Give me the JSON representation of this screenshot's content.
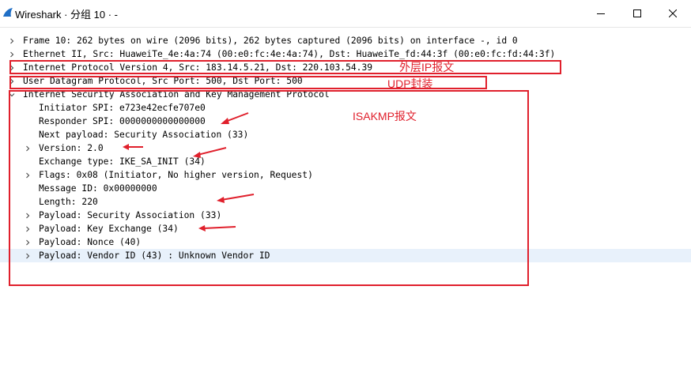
{
  "window": {
    "title": "Wireshark · 分组 10 · -",
    "controls": [
      "minimize",
      "maximize",
      "close"
    ]
  },
  "tree": {
    "rows": [
      {
        "text": "Frame 10: 262 bytes on wire (2096 bits), 262 bytes captured (2096 bits) on interface -, id 0",
        "level": 0,
        "state": "collapsed"
      },
      {
        "text": "Ethernet II, Src: HuaweiTe_4e:4a:74 (00:e0:fc:4e:4a:74), Dst: HuaweiTe_fd:44:3f (00:e0:fc:fd:44:3f)",
        "level": 0,
        "state": "collapsed"
      },
      {
        "text": "Internet Protocol Version 4, Src: 183.14.5.21, Dst: 220.103.54.39",
        "level": 0,
        "state": "collapsed"
      },
      {
        "text": "User Datagram Protocol, Src Port: 500, Dst Port: 500",
        "level": 0,
        "state": "collapsed"
      },
      {
        "text": "Internet Security Association and Key Management Protocol",
        "level": 0,
        "state": "expanded"
      },
      {
        "text": "Initiator SPI: e723e42ecfe707e0",
        "level": 1,
        "state": "none"
      },
      {
        "text": "Responder SPI: 0000000000000000",
        "level": 1,
        "state": "none"
      },
      {
        "text": "Next payload: Security Association (33)",
        "level": 1,
        "state": "none"
      },
      {
        "text": "Version: 2.0",
        "level": 1,
        "state": "collapsed"
      },
      {
        "text": "Exchange type: IKE_SA_INIT (34)",
        "level": 1,
        "state": "none"
      },
      {
        "text": "Flags: 0x08 (Initiator, No higher version, Request)",
        "level": 1,
        "state": "collapsed"
      },
      {
        "text": "Message ID: 0x00000000",
        "level": 1,
        "state": "none"
      },
      {
        "text": "Length: 220",
        "level": 1,
        "state": "none"
      },
      {
        "text": "Payload: Security Association (33)",
        "level": 1,
        "state": "collapsed"
      },
      {
        "text": "Payload: Key Exchange (34)",
        "level": 1,
        "state": "collapsed"
      },
      {
        "text": "Payload: Nonce (40)",
        "level": 1,
        "state": "collapsed"
      },
      {
        "text": "Payload: Vendor ID (43) : Unknown Vendor ID",
        "level": 1,
        "state": "collapsed",
        "selected": true
      }
    ]
  },
  "annotations": {
    "ip_label": "外层IP报文",
    "udp_label": "UDP封装",
    "isakmp_label": "ISAKMP报文",
    "color": "#e0202c"
  },
  "colors": {
    "selected_row": "#e8f1fb",
    "annotation": "#e0202c",
    "app_icon": "#1f6fc6"
  },
  "icons": [
    "wireshark-fin-icon",
    "minimize-icon",
    "maximize-icon",
    "close-icon",
    "chevron-right-icon",
    "chevron-down-icon"
  ]
}
